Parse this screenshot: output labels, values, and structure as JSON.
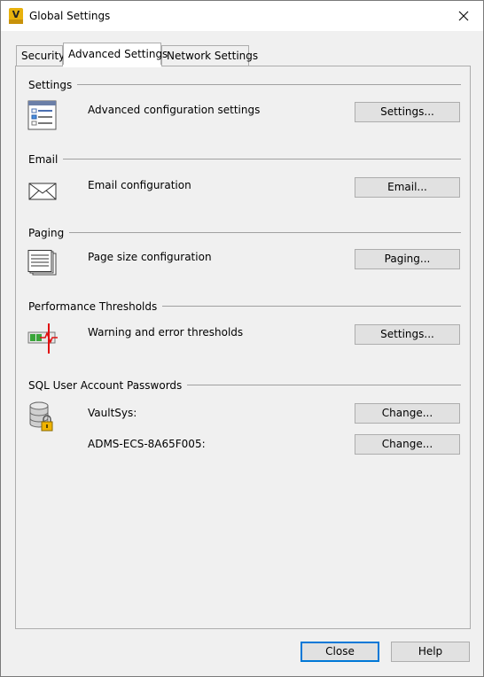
{
  "window": {
    "title": "Global Settings",
    "app_icon_letter": "V"
  },
  "tabs": [
    {
      "label": "Security",
      "active": false
    },
    {
      "label": "Advanced Settings",
      "active": true
    },
    {
      "label": "Network Settings",
      "active": false
    }
  ],
  "sections": {
    "settings": {
      "title": "Settings",
      "description": "Advanced configuration settings",
      "button": "Settings...",
      "icon": "settings-list-icon"
    },
    "email": {
      "title": "Email",
      "description": "Email configuration",
      "button": "Email...",
      "icon": "envelope-icon"
    },
    "paging": {
      "title": "Paging",
      "description": "Page size configuration",
      "button": "Paging...",
      "icon": "pages-icon"
    },
    "performance": {
      "title": "Performance Thresholds",
      "description": "Warning and error thresholds",
      "button": "Settings...",
      "icon": "threshold-meter-icon"
    },
    "sql": {
      "title": "SQL User Account Passwords",
      "icon": "database-lock-icon",
      "accounts": [
        {
          "label": "VaultSys:",
          "button": "Change..."
        },
        {
          "label": "ADMS-ECS-8A65F005:",
          "button": "Change..."
        }
      ]
    }
  },
  "footer": {
    "close_label": "Close",
    "help_label": "Help"
  },
  "colors": {
    "default_button_border": "#0078d7",
    "app_icon": "#e8b10c",
    "threshold_red": "#e01010",
    "threshold_green": "#3aa53a"
  }
}
